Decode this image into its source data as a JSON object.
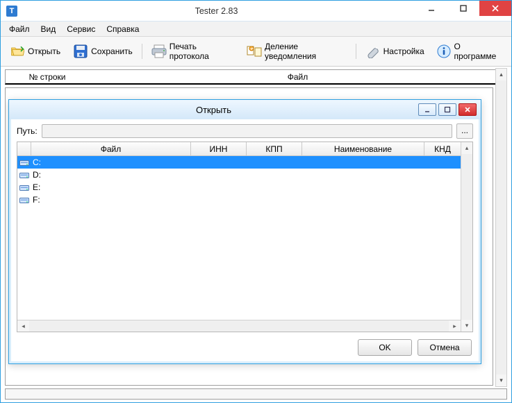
{
  "window": {
    "title": "Tester 2.83",
    "icon_letter": "T"
  },
  "menu": {
    "file": "Файл",
    "view": "Вид",
    "service": "Сервис",
    "help": "Справка"
  },
  "toolbar": {
    "open": "Открыть",
    "save": "Сохранить",
    "print": "Печать протокола",
    "split": "Деление уведомления",
    "settings": "Настройка",
    "about": "О программе"
  },
  "grid": {
    "col_num": "№ строки",
    "col_file": "Файл"
  },
  "dialog": {
    "title": "Открыть",
    "path_label": "Путь:",
    "path_value": "",
    "browse": "...",
    "columns": {
      "file": "Файл",
      "inn": "ИНН",
      "kpp": "КПП",
      "name": "Наименование",
      "knd": "КНД"
    },
    "rows": [
      {
        "label": "C:",
        "selected": true
      },
      {
        "label": "D:",
        "selected": false
      },
      {
        "label": "E:",
        "selected": false
      },
      {
        "label": "F:",
        "selected": false
      }
    ],
    "ok": "OK",
    "cancel": "Отмена"
  }
}
